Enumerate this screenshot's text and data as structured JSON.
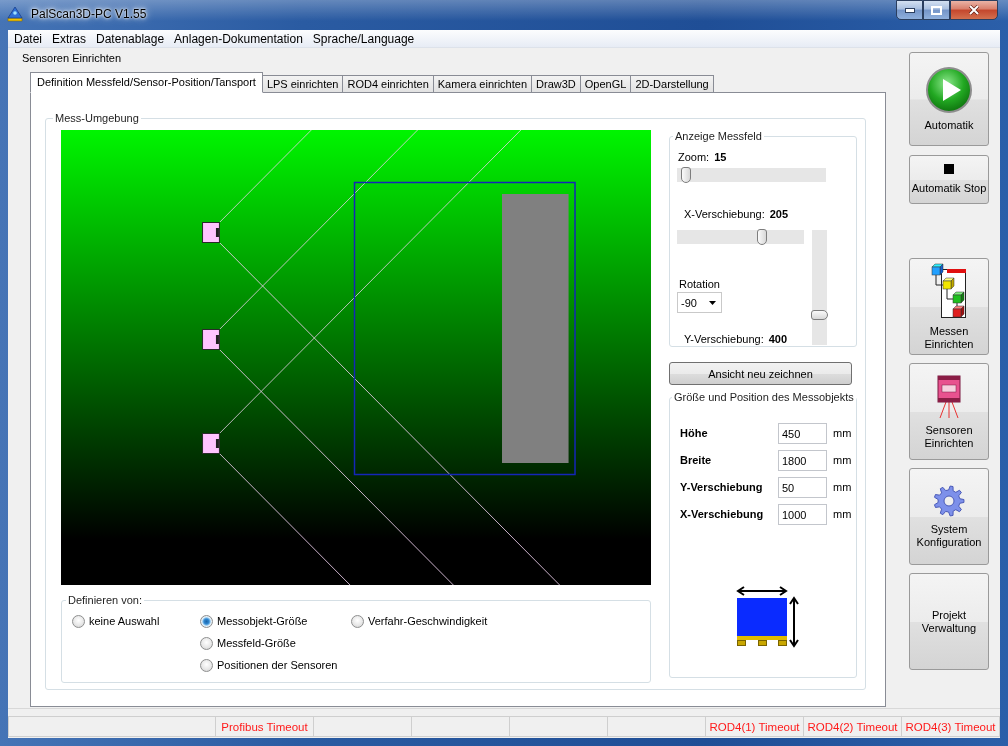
{
  "window": {
    "title": "PalScan3D-PC V1.55"
  },
  "menu": [
    "Datei",
    "Extras",
    "Datenablage",
    "Anlagen-Dokumentation",
    "Sprache/Language"
  ],
  "section_title": "Sensoren Einrichten",
  "tabs": [
    {
      "label": "Definition Messfeld/Sensor-Position/Tansport",
      "selected": true
    },
    {
      "label": "LPS einrichten",
      "selected": false
    },
    {
      "label": "ROD4 einrichten",
      "selected": false
    },
    {
      "label": "Kamera einrichten",
      "selected": false
    },
    {
      "label": "Draw3D",
      "selected": false
    },
    {
      "label": "OpenGL",
      "selected": false
    },
    {
      "label": "2D-Darstellung",
      "selected": false
    }
  ],
  "measurement_environment": {
    "title": "Mess-Umgebung",
    "definition": {
      "title": "Definieren von:",
      "columns": [
        {
          "options": [
            {
              "label": "keine Auswahl",
              "selected": false
            }
          ]
        },
        {
          "options": [
            {
              "label": "Messobjekt-Größe",
              "selected": true
            },
            {
              "label": "Messfeld-Größe",
              "selected": false
            },
            {
              "label": "Positionen der Sensoren",
              "selected": false
            }
          ]
        },
        {
          "options": [
            {
              "label": "Verfahr-Geschwindigkeit",
              "selected": false
            }
          ]
        }
      ]
    },
    "display_panel": {
      "title": "Anzeige Messfeld",
      "zoom": {
        "label": "Zoom:",
        "value": "15",
        "level": 0.03
      },
      "x_shift": {
        "label": "X-Verschiebung:",
        "value": "205",
        "level": 0.68
      },
      "rotation": {
        "label": "Rotation",
        "value": "-90"
      },
      "y_shift": {
        "label": "Y-Verschiebung:",
        "value": "400",
        "level": 0.24
      }
    },
    "redraw_button": "Ansicht neu zeichnen",
    "object_panel": {
      "title": "Größe und Position des Messobjekts",
      "fields": [
        {
          "label": "Höhe",
          "value": "450",
          "unit": "mm"
        },
        {
          "label": "Breite",
          "value": "1800",
          "unit": "mm"
        },
        {
          "label": "Y-Verschiebung",
          "value": "50",
          "unit": "mm"
        },
        {
          "label": "X-Verschiebung",
          "value": "1000",
          "unit": "mm"
        }
      ]
    }
  },
  "sidebar": {
    "run_buttons": [
      {
        "kind": "play",
        "label": "Automatik"
      },
      {
        "kind": "stop",
        "label": "Automatik Stop"
      }
    ],
    "setup_buttons": [
      {
        "kind": "flowchart",
        "label": "Messen Einrichten"
      },
      {
        "kind": "sensor",
        "label": "Sensoren Einrichten"
      },
      {
        "kind": "gear",
        "label": "System Konfiguration"
      },
      {
        "kind": "text",
        "label": "Projekt Verwaltung"
      }
    ]
  },
  "status_bar": {
    "panels": [
      {
        "kind": "blank"
      },
      {
        "kind": "message",
        "text": "Profibus Timeout"
      },
      {
        "kind": "blank"
      },
      {
        "kind": "blank"
      },
      {
        "kind": "blank"
      },
      {
        "kind": "blank"
      },
      {
        "kind": "message",
        "text": "ROD4(1) Timeout"
      },
      {
        "kind": "message",
        "text": "ROD4(2) Timeout"
      },
      {
        "kind": "message",
        "text": "ROD4(3) Timeout"
      }
    ]
  }
}
